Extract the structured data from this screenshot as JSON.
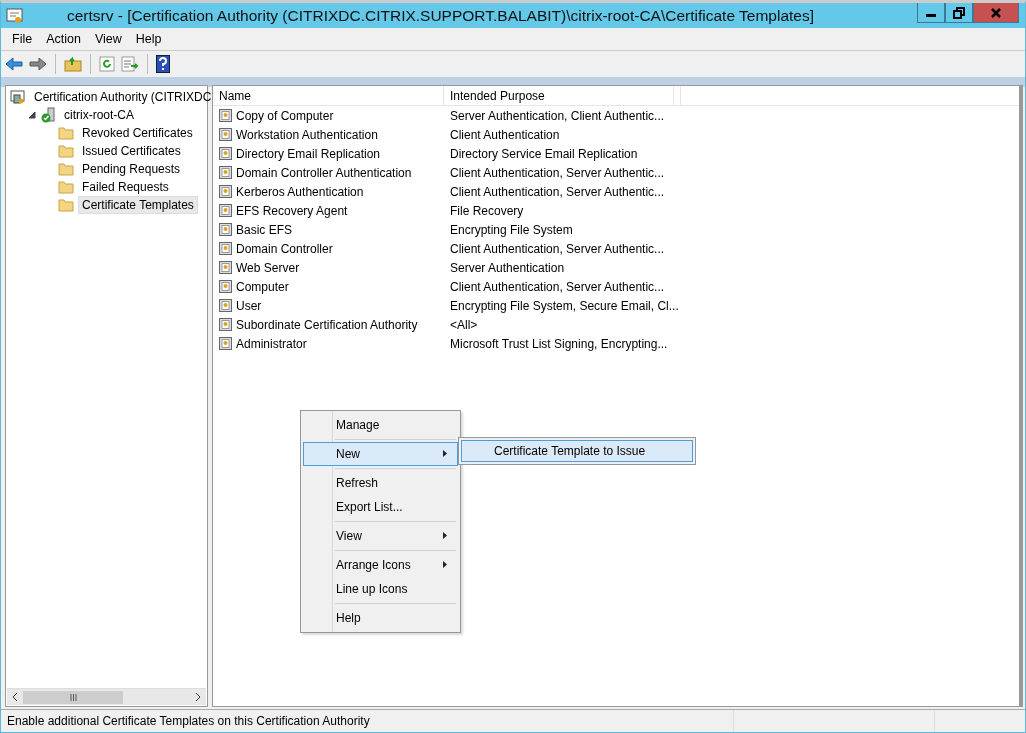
{
  "window": {
    "title": "certsrv - [Certification Authority (CITRIXDC.CITRIX.SUPPORT.BALABIT)\\citrix-root-CA\\Certificate Templates]"
  },
  "menu_bar": [
    "File",
    "Action",
    "View",
    "Help"
  ],
  "tree": [
    {
      "label": "Certification Authority (CITRIXDC",
      "kind": "authority",
      "selected": false,
      "children": [
        {
          "label": "citrix-root-CA",
          "kind": "ca",
          "selected": false,
          "expanded": true,
          "children": [
            {
              "label": "Revoked Certificates",
              "kind": "folder",
              "selected": false
            },
            {
              "label": "Issued Certificates",
              "kind": "folder",
              "selected": false
            },
            {
              "label": "Pending Requests",
              "kind": "folder",
              "selected": false
            },
            {
              "label": "Failed Requests",
              "kind": "folder",
              "selected": false
            },
            {
              "label": "Certificate Templates",
              "kind": "folder",
              "selected": true
            }
          ]
        }
      ]
    }
  ],
  "table": {
    "columns": [
      "Name",
      "Intended Purpose"
    ],
    "rows": [
      {
        "name": "Copy of Computer",
        "purpose": "Server Authentication, Client Authentic..."
      },
      {
        "name": "Workstation Authentication",
        "purpose": "Client Authentication"
      },
      {
        "name": "Directory Email Replication",
        "purpose": "Directory Service Email Replication"
      },
      {
        "name": "Domain Controller Authentication",
        "purpose": "Client Authentication, Server Authentic..."
      },
      {
        "name": "Kerberos Authentication",
        "purpose": "Client Authentication, Server Authentic..."
      },
      {
        "name": "EFS Recovery Agent",
        "purpose": "File Recovery"
      },
      {
        "name": "Basic EFS",
        "purpose": "Encrypting File System"
      },
      {
        "name": "Domain Controller",
        "purpose": "Client Authentication, Server Authentic..."
      },
      {
        "name": "Web Server",
        "purpose": "Server Authentication"
      },
      {
        "name": "Computer",
        "purpose": "Client Authentication, Server Authentic..."
      },
      {
        "name": "User",
        "purpose": "Encrypting File System, Secure Email, Cl..."
      },
      {
        "name": "Subordinate Certification Authority",
        "purpose": "<All>"
      },
      {
        "name": "Administrator",
        "purpose": "Microsoft Trust List Signing, Encrypting..."
      }
    ]
  },
  "context_menu": {
    "groups": [
      [
        {
          "label": "Manage",
          "submenu": false,
          "selected": false
        }
      ],
      [
        {
          "label": "New",
          "submenu": true,
          "selected": true
        }
      ],
      [
        {
          "label": "Refresh",
          "submenu": false,
          "selected": false
        },
        {
          "label": "Export List...",
          "submenu": false,
          "selected": false
        }
      ],
      [
        {
          "label": "View",
          "submenu": true,
          "selected": false
        }
      ],
      [
        {
          "label": "Arrange Icons",
          "submenu": true,
          "selected": false
        },
        {
          "label": "Line up Icons",
          "submenu": false,
          "selected": false
        }
      ],
      [
        {
          "label": "Help",
          "submenu": false,
          "selected": false
        }
      ]
    ],
    "submenu": [
      {
        "label": "Certificate Template to Issue",
        "selected": true
      }
    ]
  },
  "status_bar": "Enable additional Certificate Templates on this Certification Authority"
}
